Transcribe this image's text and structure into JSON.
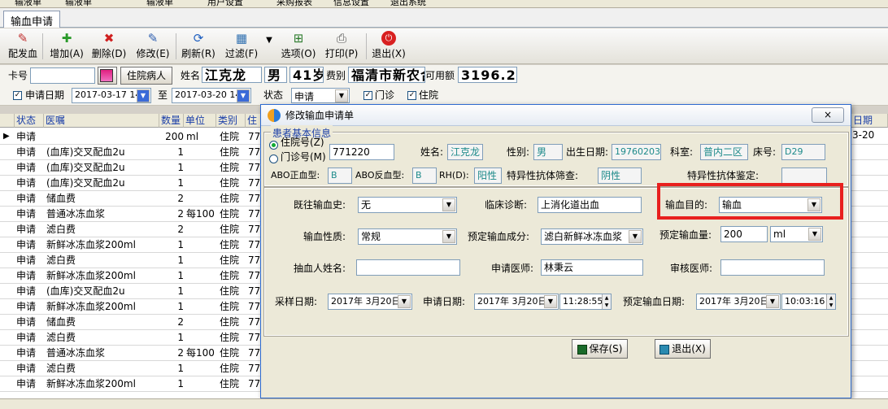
{
  "menubar": {
    "items": [
      "输液单",
      "输液单",
      "输液单",
      "用户设置",
      "采购报表",
      "信息设置",
      "退出系统"
    ]
  },
  "tab": {
    "label": "输血申请"
  },
  "toolbar": [
    {
      "label": "配发血",
      "icon": "blood-icon"
    },
    {
      "label": "增加(A)",
      "icon": "add-icon"
    },
    {
      "label": "删除(D)",
      "icon": "delete-icon"
    },
    {
      "label": "修改(E)",
      "icon": "edit-icon"
    },
    {
      "label": "刷新(R)",
      "icon": "refresh-icon"
    },
    {
      "label": "过滤(F)",
      "icon": "filter-icon"
    },
    {
      "label": "选项(O)",
      "icon": "options-icon"
    },
    {
      "label": "打印(P)",
      "icon": "print-icon"
    },
    {
      "label": "退出(X)",
      "icon": "exit-icon"
    }
  ],
  "patient": {
    "card_label": "卡号",
    "card_value": "",
    "inpatient_button": "住院病人",
    "name_label": "姓名",
    "name": "江克龙",
    "sex": "男",
    "age": "41岁",
    "fee_label": "费别",
    "fee": "福清市新农合",
    "balance_label": "可用额",
    "balance": "3196.25"
  },
  "filter": {
    "date_label": "申请日期",
    "from": "2017-03-17 14",
    "to_label": "至",
    "to": "2017-03-20 14",
    "status_label": "状态",
    "status": "申请",
    "outpatient": "门诊",
    "inpatient": "住院"
  },
  "grid": {
    "headers": [
      "状态",
      "医嘱",
      "数量",
      "单位",
      "类别",
      "住"
    ],
    "far_right_header": "日期",
    "far_right_value": "3-20",
    "rows": [
      {
        "status": "申请",
        "item": "",
        "qty": "200",
        "unit": "ml",
        "type": "住院",
        "code": "77"
      },
      {
        "status": "申请",
        "item": "(血库)交叉配血2u",
        "qty": "1",
        "unit": "",
        "type": "住院",
        "code": "77"
      },
      {
        "status": "申请",
        "item": "(血库)交叉配血2u",
        "qty": "1",
        "unit": "",
        "type": "住院",
        "code": "77"
      },
      {
        "status": "申请",
        "item": "(血库)交叉配血2u",
        "qty": "1",
        "unit": "",
        "type": "住院",
        "code": "77"
      },
      {
        "status": "申请",
        "item": "储血费",
        "qty": "2",
        "unit": "",
        "type": "住院",
        "code": "77"
      },
      {
        "status": "申请",
        "item": "普通冰冻血浆",
        "qty": "2",
        "unit": "每100",
        "type": "住院",
        "code": "77"
      },
      {
        "status": "申请",
        "item": "滤白费",
        "qty": "2",
        "unit": "",
        "type": "住院",
        "code": "77"
      },
      {
        "status": "申请",
        "item": "新鲜冰冻血浆200ml",
        "qty": "1",
        "unit": "",
        "type": "住院",
        "code": "77"
      },
      {
        "status": "申请",
        "item": "滤白费",
        "qty": "1",
        "unit": "",
        "type": "住院",
        "code": "77"
      },
      {
        "status": "申请",
        "item": "新鲜冰冻血浆200ml",
        "qty": "1",
        "unit": "",
        "type": "住院",
        "code": "77"
      },
      {
        "status": "申请",
        "item": "(血库)交叉配血2u",
        "qty": "1",
        "unit": "",
        "type": "住院",
        "code": "77"
      },
      {
        "status": "申请",
        "item": "新鲜冰冻血浆200ml",
        "qty": "1",
        "unit": "",
        "type": "住院",
        "code": "77"
      },
      {
        "status": "申请",
        "item": "储血费",
        "qty": "2",
        "unit": "",
        "type": "住院",
        "code": "77"
      },
      {
        "status": "申请",
        "item": "滤白费",
        "qty": "1",
        "unit": "",
        "type": "住院",
        "code": "77"
      },
      {
        "status": "申请",
        "item": "普通冰冻血浆",
        "qty": "2",
        "unit": "每100",
        "type": "住院",
        "code": "77"
      },
      {
        "status": "申请",
        "item": "滤白费",
        "qty": "1",
        "unit": "",
        "type": "住院",
        "code": "77"
      },
      {
        "status": "申请",
        "item": "新鲜冰冻血浆200ml",
        "qty": "1",
        "unit": "",
        "type": "住院",
        "code": "77"
      }
    ]
  },
  "dialog": {
    "title": "修改输血申请单",
    "close": "×",
    "group_title": "患者基本信息",
    "radio_inpatient": "住院号(Z)",
    "radio_outpatient": "门诊号(M)",
    "patient_no": "771220",
    "name_label": "姓名:",
    "name": "江克龙",
    "sex_label": "性别:",
    "sex": "男",
    "dob_label": "出生日期:",
    "dob": "19760203",
    "dept_label": "科室:",
    "dept": "普内二区",
    "bed_label": "床号:",
    "bed": "D29",
    "abo_label": "ABO正血型:",
    "abo": "B",
    "abo_rev_label": "ABO反血型:",
    "abo_rev": "B",
    "rh_label": "RH(D):",
    "rh": "阳性",
    "antibody_screen_label": "特异性抗体筛查:",
    "antibody_screen": "阴性",
    "antibody_id_label": "特异性抗体鉴定:",
    "antibody_id": "",
    "history_label": "既往输血史:",
    "history": "无",
    "diagnosis_label": "临床诊断:",
    "diagnosis": "上消化道出血",
    "purpose_label": "输血目的:",
    "purpose": "输血",
    "nature_label": "输血性质:",
    "nature": "常规",
    "component_label": "预定输血成分:",
    "component": "滤白新鲜冰冻血浆",
    "amount_label": "预定输血量:",
    "amount": "200",
    "amount_unit": "ml",
    "drawer_label": "抽血人姓名:",
    "drawer": "",
    "doctor_label": "申请医师:",
    "doctor": "林秉云",
    "reviewer_label": "审核医师:",
    "reviewer": "",
    "sample_date_label": "采样日期:",
    "sample_date": "2017年 3月20日",
    "apply_date_label": "申请日期:",
    "apply_date": "2017年 3月20日",
    "apply_time": "11:28:55",
    "plan_date_label": "预定输血日期:",
    "plan_date": "2017年 3月20日",
    "plan_time": "10:03:16",
    "save_button": "保存(S)",
    "exit_button": "退出(X)"
  }
}
